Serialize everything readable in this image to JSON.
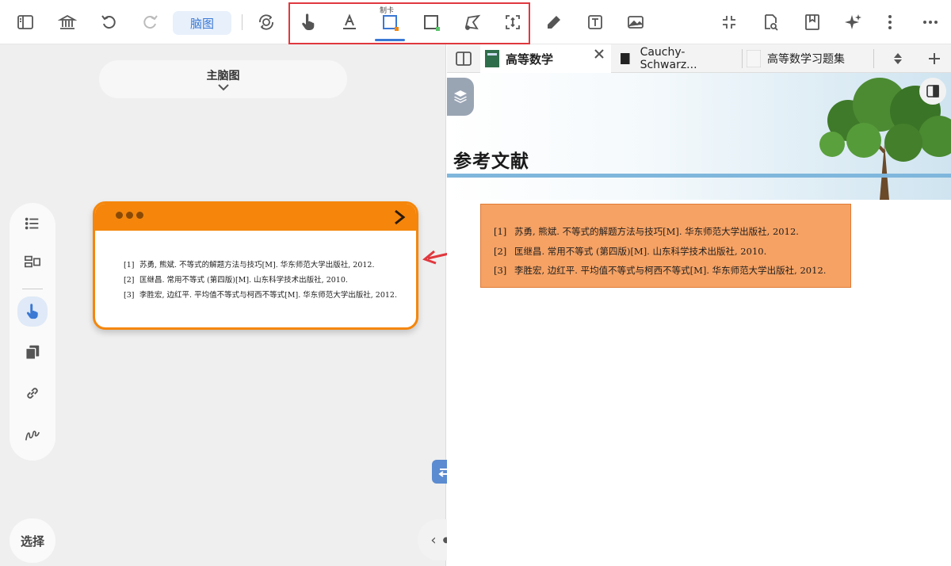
{
  "toolbar": {
    "mode_label": "脑图",
    "card_tool_label": "制卡",
    "icons": [
      "sidebar-toggle-icon",
      "library-icon",
      "undo-icon",
      "redo-icon",
      "sync-icon",
      "hand-pointer-icon",
      "text-highlight-icon",
      "card-frame-icon",
      "rect-select-icon",
      "lasso-icon",
      "area-expand-icon",
      "pen-icon",
      "text-box-icon",
      "image-icon",
      "collapse-icon",
      "search-doc-icon",
      "bookmark-icon",
      "ai-sparkle-icon",
      "more-vertical-icon",
      "more-horizontal-icon"
    ]
  },
  "mindmap": {
    "title": "主脑图"
  },
  "card": {
    "refs": [
      {
        "num": "[1]",
        "text": "苏勇, 熊斌. 不等式的解题方法与技巧[M]. 华东师范大学出版社, 2012."
      },
      {
        "num": "[2]",
        "text": "匡继昌. 常用不等式 (第四版)[M]. 山东科学技术出版社, 2010."
      },
      {
        "num": "[3]",
        "text": "李胜宏, 边红平. 平均值不等式与柯西不等式[M]. 华东师范大学出版社, 2012."
      }
    ]
  },
  "left": {
    "select_label": "选择"
  },
  "tabs": [
    {
      "label": "高等数学"
    },
    {
      "label": "Cauchy-Schwarz..."
    },
    {
      "label": "高等数学习题集"
    }
  ],
  "doc": {
    "section_title": "参考文献",
    "refs": [
      {
        "num": "[1]",
        "text": "苏勇, 熊斌. 不等式的解题方法与技巧[M]. 华东师范大学出版社, 2012."
      },
      {
        "num": "[2]",
        "text": "匡继昌. 常用不等式 (第四版)[M]. 山东科学技术出版社, 2010."
      },
      {
        "num": "[3]",
        "text": "李胜宏, 边红平. 平均值不等式与柯西不等式[M]. 华东师范大学出版社, 2012."
      }
    ]
  },
  "colors": {
    "accent_blue": "#3a78d4",
    "card_orange": "#f5860b",
    "selection_orange": "#f6a264",
    "highlight_red": "#e0383e"
  }
}
